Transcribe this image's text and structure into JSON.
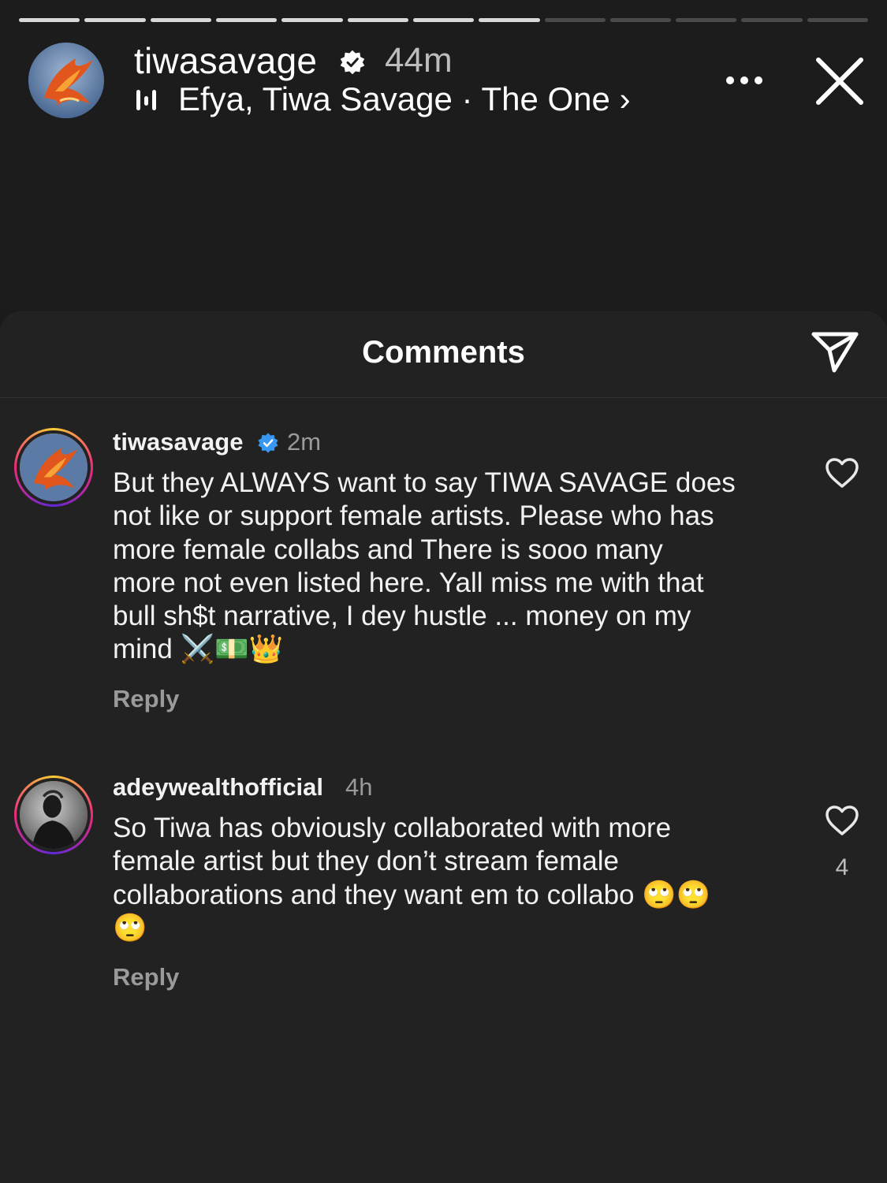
{
  "story": {
    "progress": {
      "total_segments": 13,
      "completed_segments": 8
    },
    "username": "tiwasavage",
    "time": "44m",
    "music": {
      "artists": "Efya, Tiwa Savage",
      "separator": "·",
      "track": "The One",
      "chevron": "›",
      "icon": "music-bars-icon"
    }
  },
  "sheet": {
    "title": "Comments",
    "send_icon": "paper-plane-icon"
  },
  "comments": [
    {
      "username": "tiwasavage",
      "verified": true,
      "time": "2m",
      "text_lines": [
        "But they ALWAYS want to say TIWA SAVAGE does",
        "not like or support female artists. Please who has",
        "more female collabs and There is sooo many",
        "more not even listed here. Yall miss me with that",
        "bull sh$t narrative, I dey hustle ... money on my",
        "mind ⚔️💵👑"
      ],
      "reply_label": "Reply",
      "likes": ""
    },
    {
      "username": "adeywealthofficial",
      "verified": false,
      "time": "4h",
      "text_lines": [
        "So Tiwa has obviously collaborated with more",
        "female artist but they don’t stream female",
        "collaborations and they want em to collabo 🙄🙄",
        "🙄"
      ],
      "reply_label": "Reply",
      "likes": "4"
    }
  ],
  "colors": {
    "background": "#1b1b1b",
    "sheet": "#222222",
    "verified_blue": "#3897f0",
    "muted_text": "#9a9a9a"
  }
}
